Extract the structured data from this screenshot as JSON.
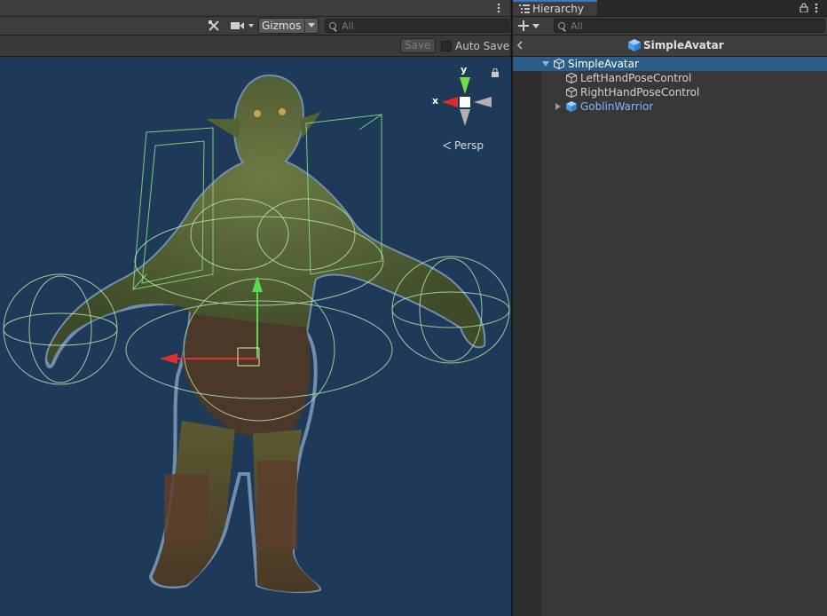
{
  "scene": {
    "toolbar": {
      "tools_icon": "tools-icon",
      "camera_icon": "camera-icon",
      "gizmos_label": "Gizmos",
      "search_placeholder": "All",
      "menu_icon": "kebab-menu-icon"
    },
    "prefab_bar": {
      "save_label": "Save",
      "auto_save_label": "Auto Save",
      "auto_save_checked": false
    },
    "orientation_gizmo": {
      "y_label": "y",
      "x_label": "x",
      "projection_label": "Persp",
      "lock_icon": "lock-icon"
    }
  },
  "hierarchy": {
    "tab_label": "Hierarchy",
    "tab_icon": "list-icon",
    "lock_icon": "lock-icon",
    "menu_icon": "kebab-menu-icon",
    "add_icon": "plus-icon",
    "search_placeholder": "All",
    "header": {
      "back_icon": "chevron-left-icon",
      "title": "SimpleAvatar",
      "icon": "prefab-cube-icon"
    },
    "items": [
      {
        "label": "SimpleAvatar",
        "depth": 0,
        "expanded": true,
        "selected": true,
        "icon": "gameobject-cube-icon"
      },
      {
        "label": "LeftHandPoseControl",
        "depth": 1,
        "icon": "gameobject-cube-icon"
      },
      {
        "label": "RightHandPoseControl",
        "depth": 1,
        "icon": "gameobject-cube-icon"
      },
      {
        "label": "GoblinWarrior",
        "depth": 1,
        "expanded": false,
        "prefab": true,
        "icon": "prefab-cube-icon"
      }
    ]
  },
  "colors": {
    "selection": "#2c5d87",
    "prefab_text": "#7cb7ff",
    "viewport_bg": "#1f3a58",
    "accent_tab": "#3a79bb"
  }
}
